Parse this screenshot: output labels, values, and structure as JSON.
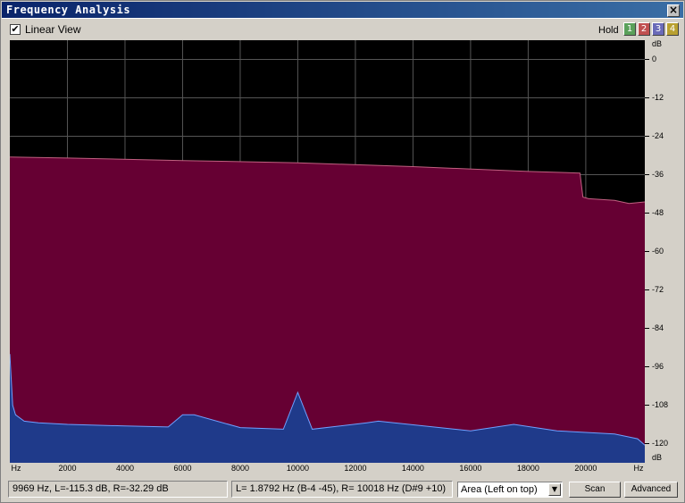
{
  "window": {
    "title": "Frequency Analysis",
    "close_glyph": "×"
  },
  "toolbar": {
    "linear_view_checked": true,
    "check_glyph": "✔",
    "linear_view_label": "Linear View",
    "hold_label": "Hold",
    "hold_buttons": [
      {
        "label": "1",
        "color": "#5aa05a"
      },
      {
        "label": "2",
        "color": "#c05050"
      },
      {
        "label": "3",
        "color": "#6a6ab8"
      },
      {
        "label": "4",
        "color": "#b8a030"
      }
    ]
  },
  "chart_data": {
    "type": "area",
    "title": "",
    "xlabel": "Hz",
    "ylabel": "dB",
    "x_unit_label": "Hz",
    "y_unit_label": "dB",
    "xlim": [
      0,
      22050
    ],
    "ylim": [
      -126,
      6
    ],
    "x_ticks": [
      "2000",
      "4000",
      "6000",
      "8000",
      "10000",
      "12000",
      "14000",
      "16000",
      "18000",
      "20000"
    ],
    "y_ticks": [
      "0",
      "-12",
      "-24",
      "-36",
      "-48",
      "-60",
      "-72",
      "-84",
      "-96",
      "-108",
      "-120"
    ],
    "grid": true,
    "series": [
      {
        "channel": "R",
        "color": "#660033",
        "line_color": "#c06080",
        "x": [
          0,
          2000,
          6000,
          10000,
          14000,
          18000,
          19800,
          19900,
          20100,
          21000,
          21500,
          22050
        ],
        "y": [
          -30.5,
          -30.8,
          -31.6,
          -32.3,
          -33.5,
          -35.0,
          -35.5,
          -43.0,
          -43.5,
          -44.0,
          -45.0,
          -44.5
        ]
      },
      {
        "channel": "L",
        "color": "#1f3a8a",
        "line_color": "#6ea0ff",
        "x": [
          0,
          100,
          200,
          500,
          1000,
          2000,
          4000,
          5500,
          6000,
          6400,
          8000,
          9500,
          10000,
          10500,
          12400,
          12800,
          16000,
          17500,
          19000,
          20000,
          21000,
          21800,
          22050
        ],
        "y": [
          -92,
          -108,
          -111,
          -113,
          -113.5,
          -114,
          -114.5,
          -114.8,
          -111,
          -111,
          -115,
          -115.5,
          -104,
          -115.5,
          -113.5,
          -113,
          -116,
          -114,
          -116,
          -116.5,
          -117,
          -118.5,
          -120.5
        ]
      }
    ]
  },
  "status": {
    "cursor": "9969 Hz, L=-115.3 dB, R=-32.29 dB",
    "peak": "L= 1.8792 Hz (B-4 -45), R=  10018 Hz (D#9 +10)"
  },
  "controls": {
    "mode_select": "Area (Left on top)",
    "select_arrow_glyph": "▼",
    "scan_label": "Scan",
    "advanced_label": "Advanced"
  }
}
